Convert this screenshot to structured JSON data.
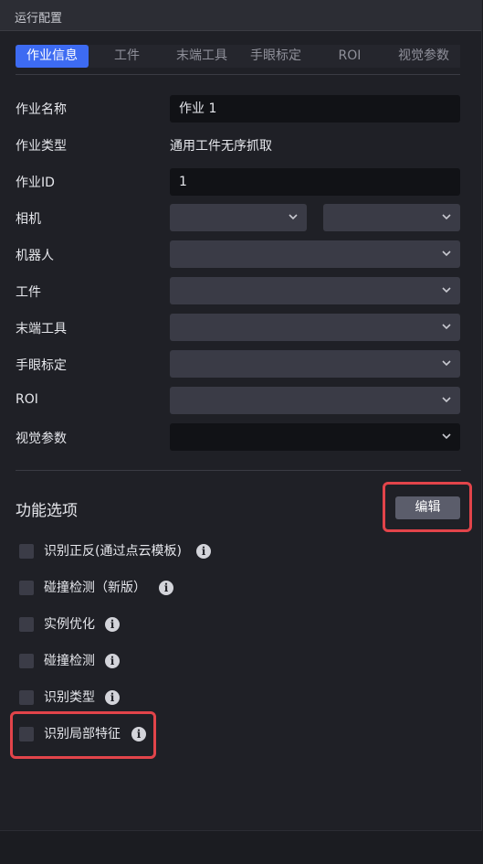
{
  "window": {
    "title": "运行配置"
  },
  "tabs": [
    {
      "label": "作业信息",
      "active": true
    },
    {
      "label": "工件"
    },
    {
      "label": "末端工具"
    },
    {
      "label": "手眼标定"
    },
    {
      "label": "ROI"
    },
    {
      "label": "视觉参数"
    }
  ],
  "form": {
    "job_name": {
      "label": "作业名称",
      "value": "作业 1"
    },
    "job_type": {
      "label": "作业类型",
      "value": "通用工件无序抓取"
    },
    "job_id": {
      "label": "作业ID",
      "value": "1"
    },
    "camera": {
      "label": "相机"
    },
    "robot": {
      "label": "机器人"
    },
    "workpiece": {
      "label": "工件"
    },
    "end_tool": {
      "label": "末端工具"
    },
    "hand_eye": {
      "label": "手眼标定"
    },
    "roi": {
      "label": "ROI"
    },
    "vision_params": {
      "label": "视觉参数"
    }
  },
  "features": {
    "title": "功能选项",
    "edit_label": "编辑",
    "options": [
      {
        "label": "识别正反(通过点云模板)",
        "checked": false
      },
      {
        "label": "碰撞检测（新版）",
        "checked": false
      },
      {
        "label": "实例优化",
        "checked": false
      },
      {
        "label": "碰撞检测",
        "checked": false
      },
      {
        "label": "识别类型",
        "checked": false
      },
      {
        "label": "识别局部特征",
        "checked": false
      }
    ],
    "info_glyph": "i"
  },
  "colors": {
    "accent": "#3d6bf2",
    "highlight": "#e2444a",
    "panel_bg": "#1f2026",
    "select_bg": "#3a3b46"
  },
  "icons": {
    "dropdown": "chevron-down-icon",
    "info": "info-icon"
  }
}
